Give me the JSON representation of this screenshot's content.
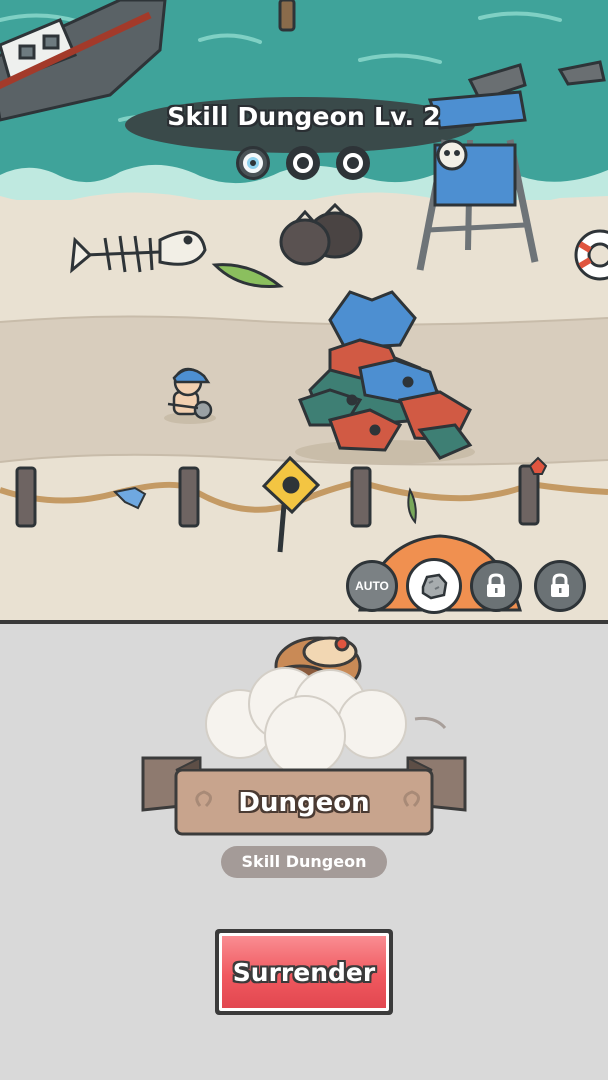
{
  "hud": {
    "dungeon_title": "Skill Dungeon Lv. 2",
    "stages": [
      {
        "state": "current",
        "icon": "eye-icon"
      },
      {
        "state": "upcoming",
        "icon": "ring-icon"
      },
      {
        "state": "upcoming",
        "icon": "ring-icon"
      }
    ],
    "controls": {
      "auto_label": "AUTO",
      "skill_slot_icon": "rock-icon",
      "locked_slot_icon": "lock-icon"
    }
  },
  "panel": {
    "banner_label": "Dungeon",
    "subtitle": "Skill Dungeon",
    "surrender_label": "Surrender"
  },
  "colors": {
    "sea": "#3fa39a",
    "sand": "#e9e1d2",
    "path": "#d8cdbd",
    "panel_bg": "#d9d9d9",
    "surrender_red": "#f0595f",
    "banner_brown": "#c8a48d"
  }
}
